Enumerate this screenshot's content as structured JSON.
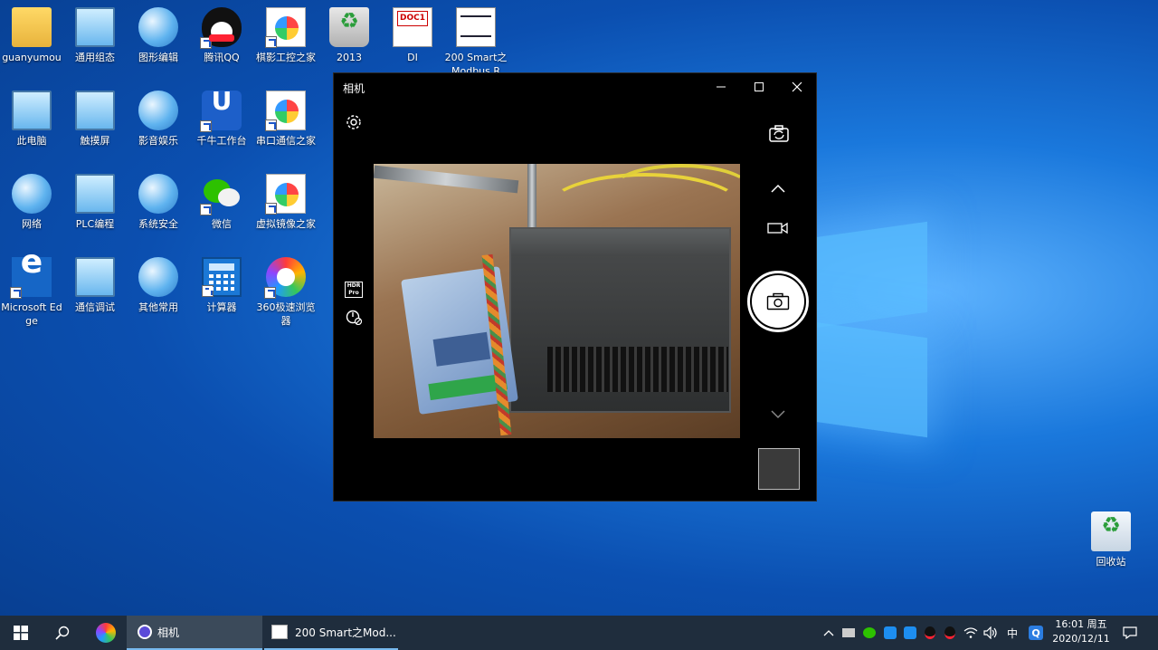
{
  "desktop": {
    "icons": [
      {
        "label": "guanyumou",
        "icon": "user-folder-icon"
      },
      {
        "label": "通用组态",
        "icon": "computer-icon"
      },
      {
        "label": "图形编辑",
        "icon": "network-globe-icon"
      },
      {
        "label": "腾讯QQ",
        "icon": "qq-icon"
      },
      {
        "label": "棋影工控之家",
        "icon": "document-icon"
      },
      {
        "label": "2013",
        "icon": "recycle-folder-icon"
      },
      {
        "label": "DI",
        "icon": "doc-file-icon"
      },
      {
        "label": "200 Smart之Modbus R",
        "icon": "ladder-project-icon"
      },
      {
        "label": "此电脑",
        "icon": "this-pc-icon"
      },
      {
        "label": "触摸屏",
        "icon": "computer-icon"
      },
      {
        "label": "影音娱乐",
        "icon": "network-globe-icon"
      },
      {
        "label": "千牛工作台",
        "icon": "qianniu-icon"
      },
      {
        "label": "串口通信之家",
        "icon": "document-icon"
      },
      {
        "label": "网络",
        "icon": "network-icon"
      },
      {
        "label": "PLC编程",
        "icon": "computer-icon"
      },
      {
        "label": "系统安全",
        "icon": "network-globe-icon"
      },
      {
        "label": "微信",
        "icon": "wechat-icon"
      },
      {
        "label": "虚拟镜像之家",
        "icon": "document-icon"
      },
      {
        "label": "Microsoft Edge",
        "icon": "edge-icon"
      },
      {
        "label": "通信调试",
        "icon": "computer-icon"
      },
      {
        "label": "其他常用",
        "icon": "network-globe-icon"
      },
      {
        "label": "计算器",
        "icon": "calculator-icon"
      },
      {
        "label": "360极速浏览器",
        "icon": "browser-360-icon"
      }
    ],
    "recycle_bin": {
      "label": "回收站",
      "icon": "recycle-bin-icon"
    }
  },
  "camera_window": {
    "title": "相机",
    "controls": {
      "minimize": "—",
      "maximize": "☐",
      "close": "✕"
    },
    "hdr_label": "HDR Pro"
  },
  "taskbar": {
    "apps": [
      {
        "label": "相机",
        "icon": "camera-app-icon",
        "active": true
      },
      {
        "label": "200 Smart之Mod...",
        "icon": "ladder-project-icon",
        "active": false
      }
    ],
    "tray": {
      "ime": "中",
      "time": "16:01 周五",
      "date": "2020/12/11"
    }
  }
}
